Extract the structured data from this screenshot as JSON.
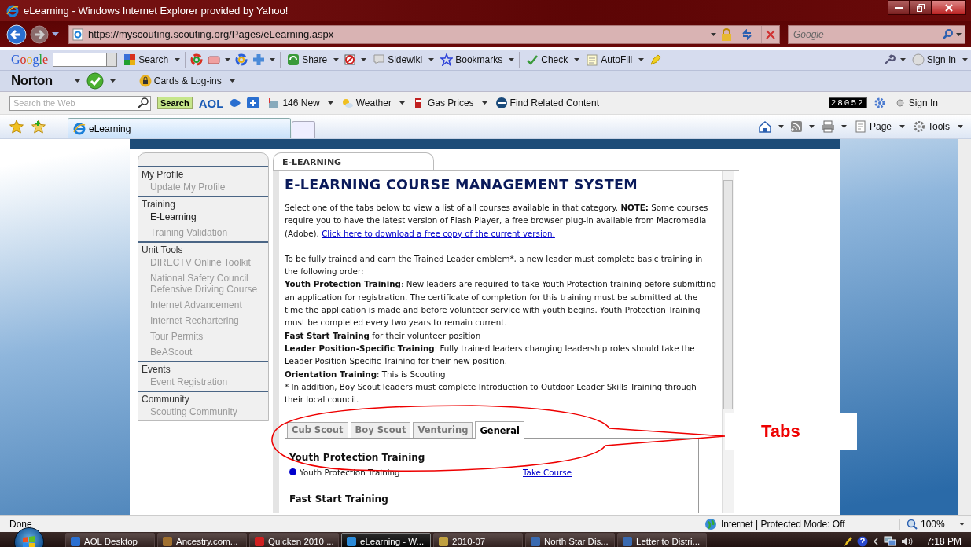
{
  "window": {
    "title": "eLearning - Windows Internet Explorer provided by Yahoo!"
  },
  "address_bar": {
    "url": "https://myscouting.scouting.org/Pages/eLearning.aspx",
    "search_placeholder": "Google"
  },
  "google_toolbar": {
    "brand": "Google",
    "search": "Search",
    "share": "Share",
    "sidewiki": "Sidewiki",
    "bookmarks": "Bookmarks",
    "check": "Check",
    "autofill": "AutoFill",
    "sign_in": "Sign In"
  },
  "norton_toolbar": {
    "brand": "Norton",
    "cards": "Cards & Log-ins"
  },
  "aol_toolbar": {
    "search_placeholder": "Search the Web",
    "search_button": "Search",
    "brand": "AOL",
    "mail": "146 New",
    "weather": "Weather",
    "gas": "Gas Prices",
    "related": "Find Related Content",
    "counter": "28052",
    "sign_in": "Sign In"
  },
  "browser_tabs": [
    {
      "label": "eLearning",
      "selected": true
    }
  ],
  "command_bar": {
    "page": "Page",
    "tools": "Tools"
  },
  "sidebar": {
    "sections": [
      {
        "label": "My Profile",
        "children": [
          {
            "label": "Update My Profile",
            "selected": false
          }
        ]
      },
      {
        "label": "Training",
        "children": [
          {
            "label": "E-Learning",
            "selected": true
          },
          {
            "label": "Training Validation",
            "selected": false
          }
        ]
      },
      {
        "label": "Unit Tools",
        "children": [
          {
            "label": "DIRECTV Online Toolkit",
            "selected": false
          },
          {
            "label": "National Safety Council Defensive Driving Course",
            "selected": false
          },
          {
            "label": "Internet Advancement",
            "selected": false
          },
          {
            "label": "Internet Rechartering",
            "selected": false
          },
          {
            "label": "Tour Permits",
            "selected": false
          },
          {
            "label": "BeAScout",
            "selected": false
          }
        ]
      },
      {
        "label": "Events",
        "children": [
          {
            "label": "Event Registration",
            "selected": false
          }
        ]
      },
      {
        "label": "Community",
        "children": [
          {
            "label": "Scouting Community",
            "selected": false
          }
        ]
      }
    ]
  },
  "content": {
    "section_tab": "E-LEARNING",
    "heading": "E-LEARNING COURSE MANAGEMENT SYSTEM",
    "intro": "Select one of the tabs below to view a list of all courses available in that category. **NOTE:** Some courses require you to have the latest version of Flash Player, a free browser plug-in available from Macromedia (Adobe). ",
    "intro_link": "Click here to download a free copy of the current version.",
    "paragraphs": [
      "To be fully trained and earn the Trained Leader emblem*, a new leader must complete basic training in the following order:",
      "**Youth Protection Training**: New leaders are required to take Youth Protection training before submitting an application for registration. The certificate of completion for this training must be submitted at the time the application is made and before volunteer service with youth begins. Youth Protection Training must be completed every two years to remain current.",
      "**Fast Start Training** for their volunteer position",
      "**Leader Position-Specific Training**: Fully trained leaders changing leadership roles should take the Leader Position-Specific Training for their new position.",
      "**Orientation Training**: This is Scouting",
      "* In addition, Boy Scout leaders must complete Introduction to Outdoor Leader Skills Training through their local council."
    ],
    "course_tabs": [
      {
        "label": "Cub Scout",
        "selected": false
      },
      {
        "label": "Boy Scout",
        "selected": false
      },
      {
        "label": "Venturing",
        "selected": false
      },
      {
        "label": "General",
        "selected": true
      }
    ],
    "course_groups": [
      {
        "title": "Youth Protection Training",
        "courses": [
          {
            "name": "Youth Protection Training",
            "link": "Take Course",
            "color": "#0000cc"
          }
        ]
      },
      {
        "title": "Fast Start Training"
      }
    ]
  },
  "annotation": {
    "label": "Tabs"
  },
  "status_bar": {
    "text": "Done",
    "zone": "Internet | Protected Mode: Off",
    "zoom": "100%"
  },
  "taskbar": {
    "items": [
      {
        "label": "AOL Desktop",
        "selected": false
      },
      {
        "label": "Ancestry.com...",
        "selected": false
      },
      {
        "label": "Quicken 2010 ...",
        "selected": false
      },
      {
        "label": "eLearning - W...",
        "selected": true
      },
      {
        "label": "2010-07",
        "selected": false
      },
      {
        "label": "North Star Dis...",
        "selected": false
      },
      {
        "label": "Letter to Distri...",
        "selected": false
      }
    ],
    "time": "7:18 PM"
  }
}
